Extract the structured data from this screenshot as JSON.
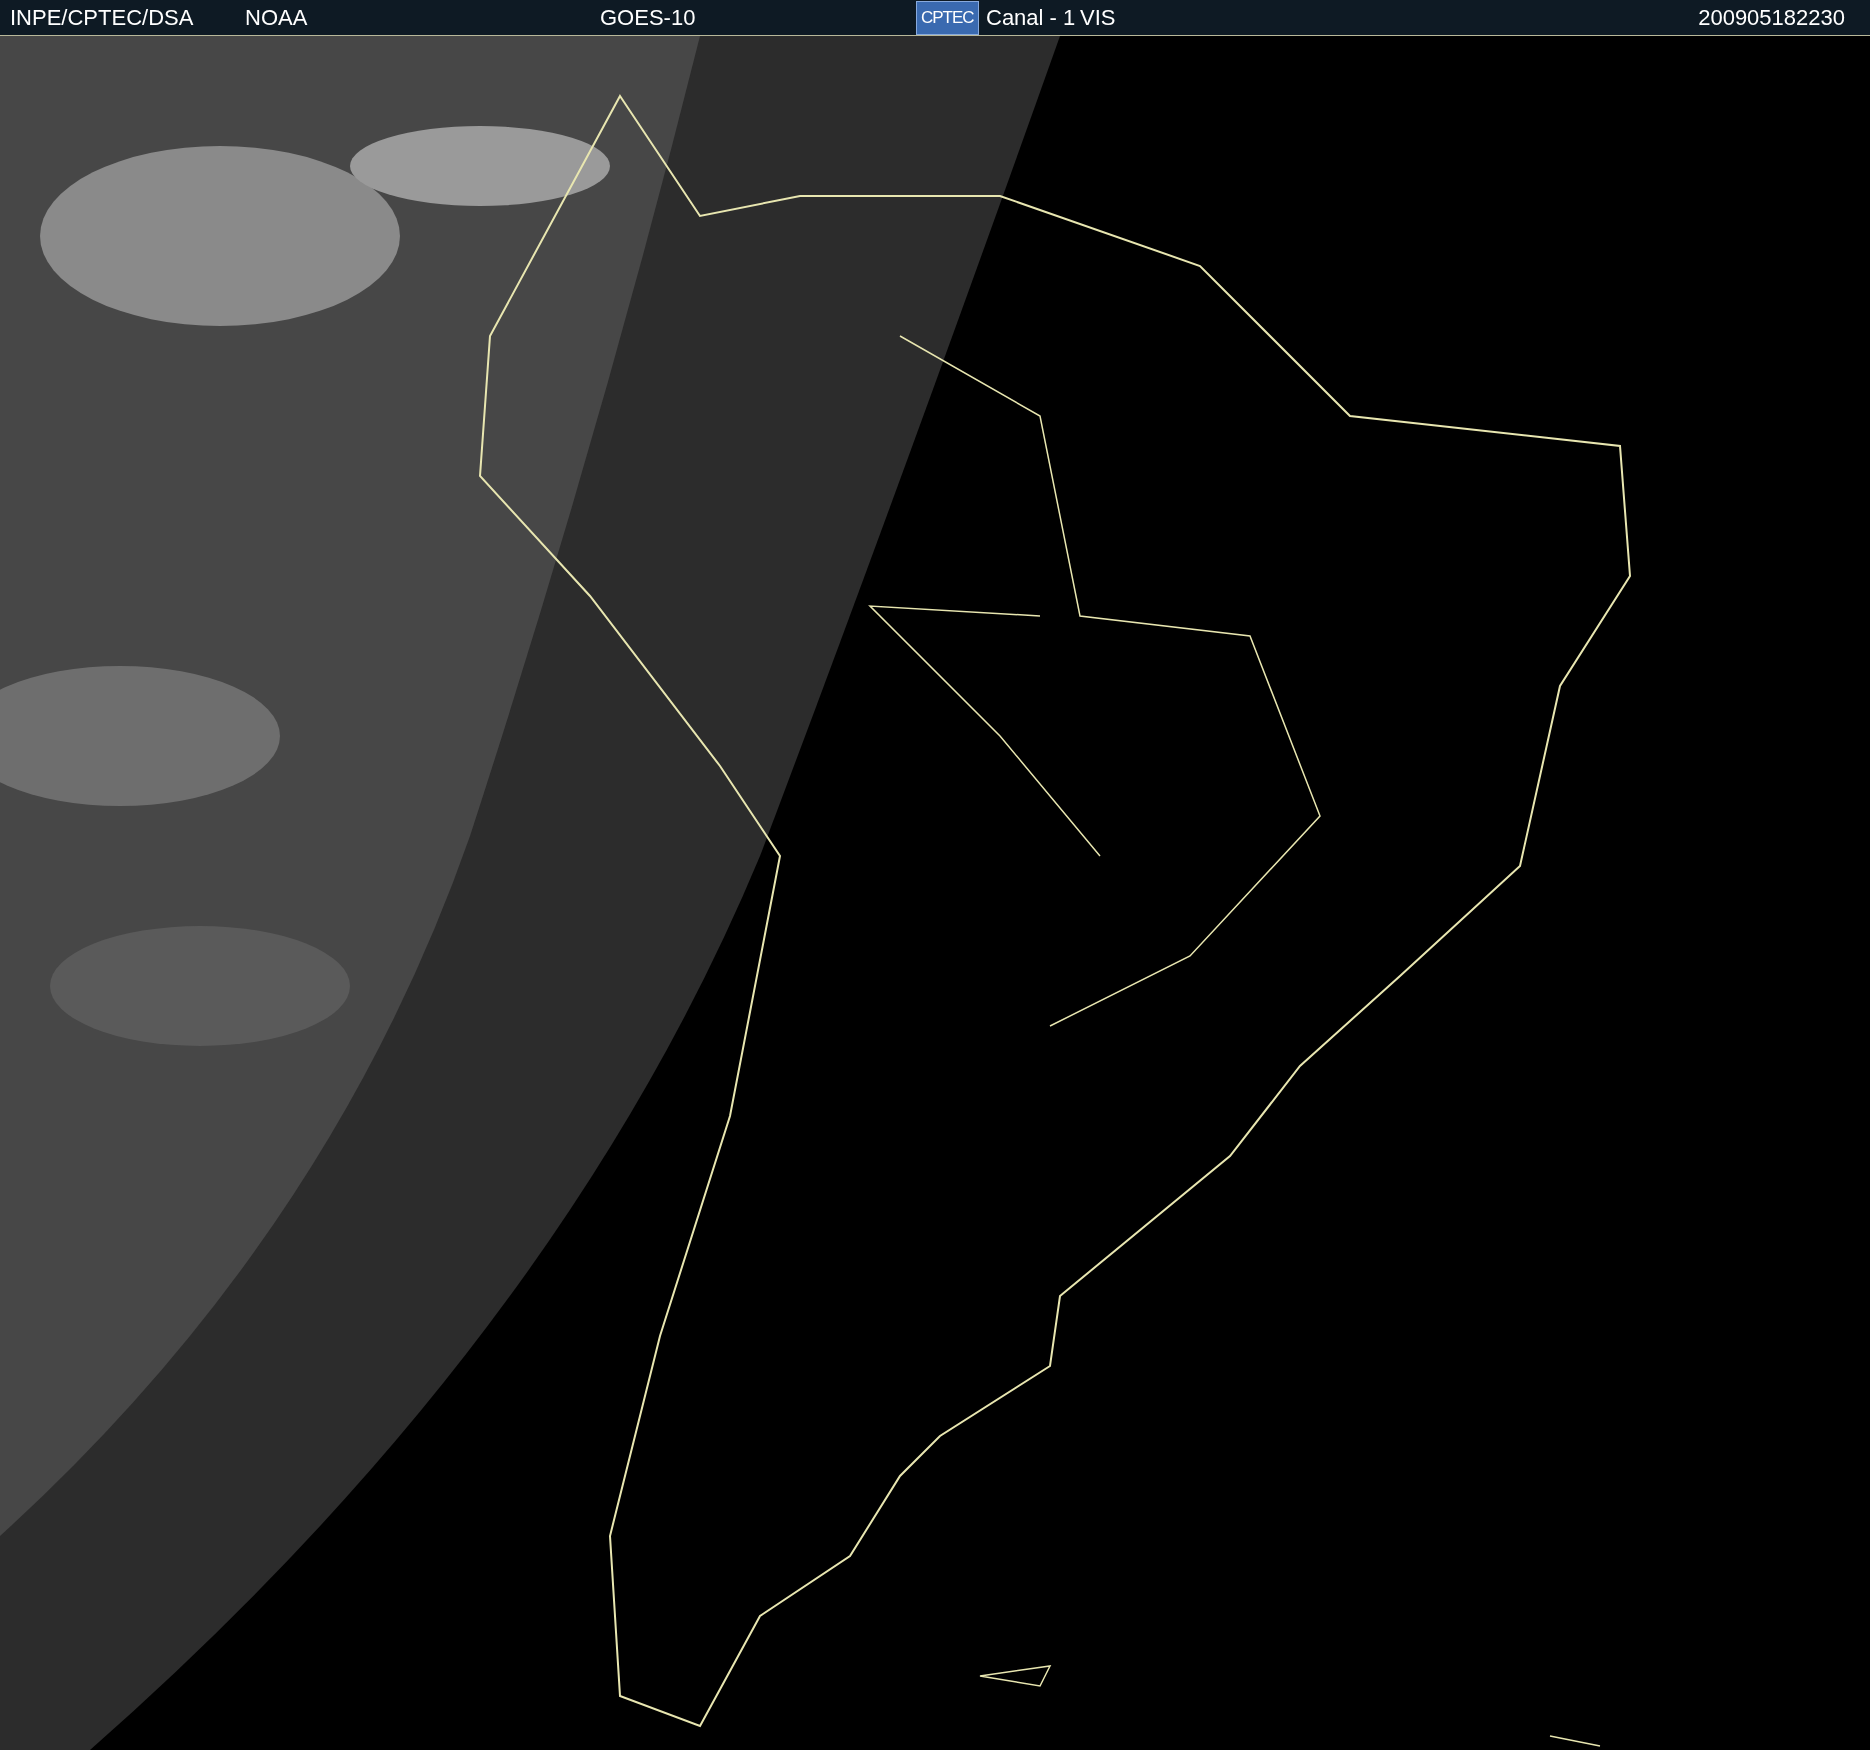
{
  "header": {
    "source": "INPE/CPTEC/DSA",
    "agency": "NOAA",
    "satellite": "GOES-10",
    "logo": "CPTEC",
    "channel": "Canal - 1",
    "band": "VIS",
    "timestamp": "200905182230"
  }
}
